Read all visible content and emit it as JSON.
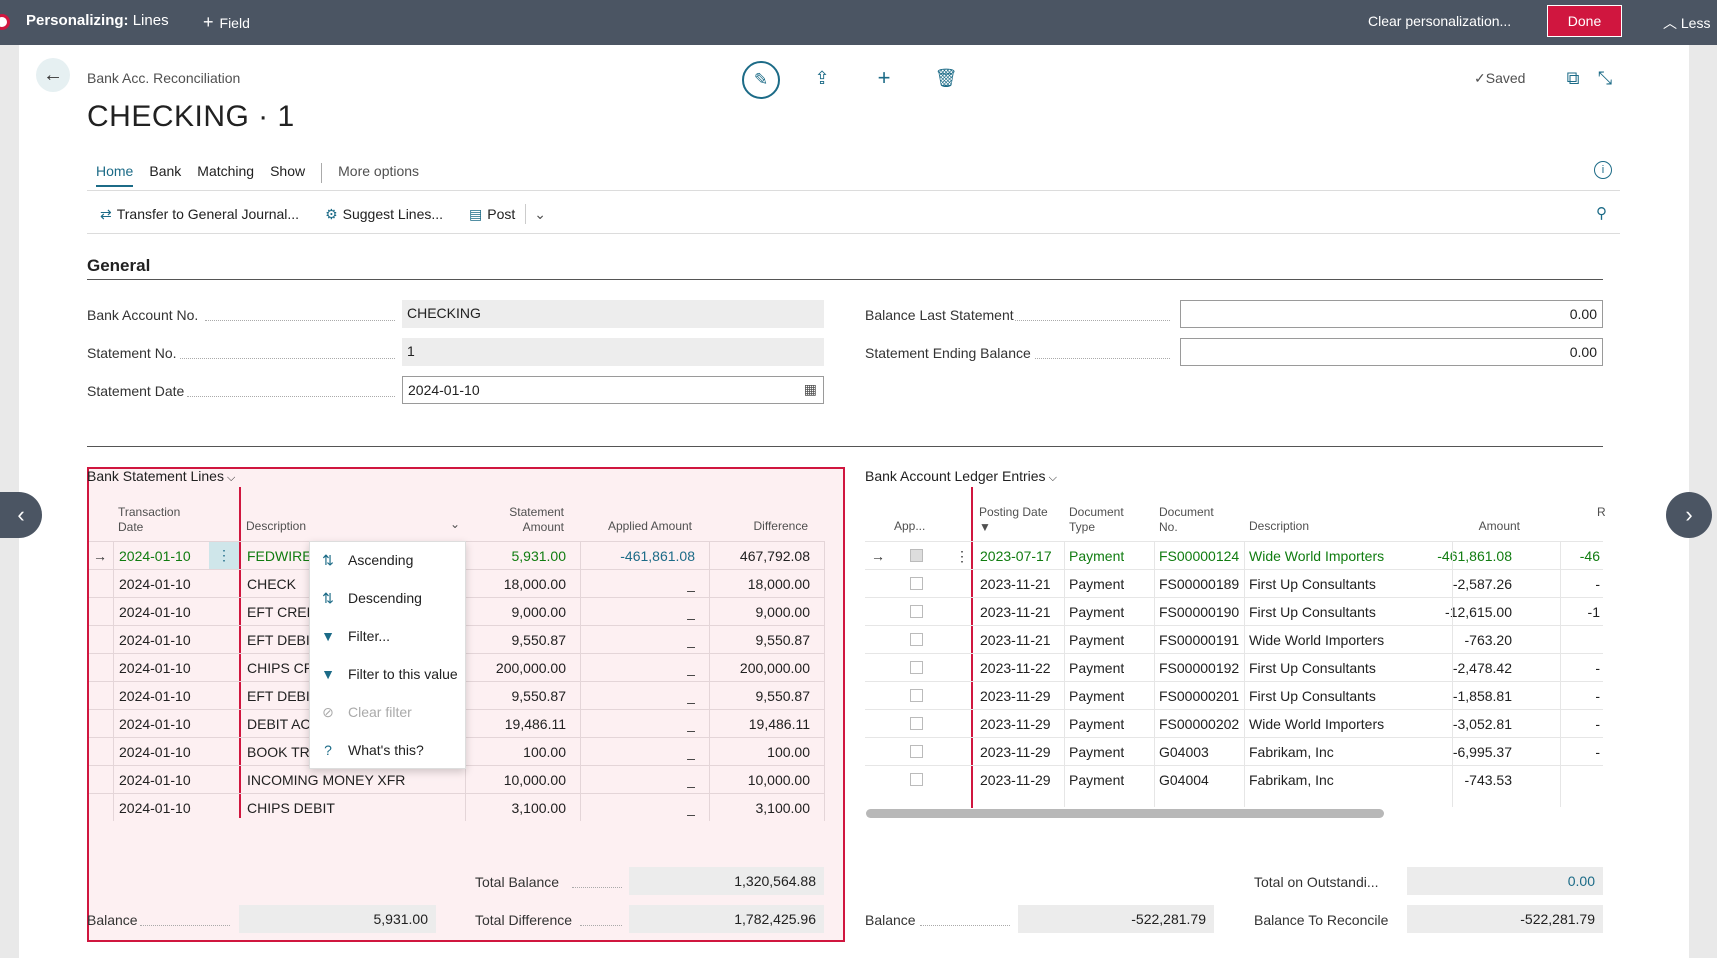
{
  "topbar": {
    "title_bold": "Personalizing:",
    "title_rest": "Lines",
    "field": "Field",
    "clear": "Clear personalization...",
    "done": "Done",
    "less": "Less"
  },
  "header": {
    "breadcrumb": "Bank Acc. Reconciliation",
    "title": "CHECKING · 1",
    "saved": "Saved"
  },
  "tabs": [
    "Home",
    "Bank",
    "Matching",
    "Show",
    "More options"
  ],
  "toolbar": {
    "transfer": "Transfer to General Journal...",
    "suggest": "Suggest Lines...",
    "post": "Post"
  },
  "general": {
    "heading": "General",
    "bank_account_no_label": "Bank Account No.",
    "bank_account_no": "CHECKING",
    "statement_no_label": "Statement No.",
    "statement_no": "1",
    "statement_date_label": "Statement Date",
    "statement_date": "2024-01-10",
    "balance_last_label": "Balance Last Statement",
    "balance_last": "0.00",
    "ending_balance_label": "Statement Ending Balance",
    "ending_balance": "0.00"
  },
  "lines": {
    "title": "Bank Statement Lines",
    "headers": {
      "date1": "Transaction",
      "date2": "Date",
      "desc": "Description",
      "amt1": "Statement",
      "amt2": "Amount",
      "applied": "Applied Amount",
      "diff": "Difference"
    },
    "rows": [
      {
        "date": "2024-01-10",
        "desc": "FEDWIRE",
        "amount": "5,931.00",
        "applied": "-461,861.08",
        "diff": "467,792.08"
      },
      {
        "date": "2024-01-10",
        "desc": "CHECK",
        "amount": "18,000.00",
        "applied": "_",
        "diff": "18,000.00"
      },
      {
        "date": "2024-01-10",
        "desc": "EFT CRED",
        "amount": "9,000.00",
        "applied": "_",
        "diff": "9,000.00"
      },
      {
        "date": "2024-01-10",
        "desc": "EFT DEBIT",
        "amount": "9,550.87",
        "applied": "_",
        "diff": "9,550.87"
      },
      {
        "date": "2024-01-10",
        "desc": "CHIPS CR",
        "amount": "200,000.00",
        "applied": "_",
        "diff": "200,000.00"
      },
      {
        "date": "2024-01-10",
        "desc": "EFT DEBIT",
        "amount": "9,550.87",
        "applied": "_",
        "diff": "9,550.87"
      },
      {
        "date": "2024-01-10",
        "desc": "DEBIT AC",
        "amount": "19,486.11",
        "applied": "_",
        "diff": "19,486.11"
      },
      {
        "date": "2024-01-10",
        "desc": "BOOK TR",
        "amount": "100.00",
        "applied": "_",
        "diff": "100.00"
      },
      {
        "date": "2024-01-10",
        "desc": "INCOMING MONEY XFR",
        "amount": "10,000.00",
        "applied": "_",
        "diff": "10,000.00"
      },
      {
        "date": "2024-01-10",
        "desc": "CHIPS DEBIT",
        "amount": "3,100.00",
        "applied": "_",
        "diff": "3,100.00"
      }
    ],
    "total_balance_label": "Total Balance",
    "total_balance": "1,320,564.88",
    "balance_label": "Balance",
    "balance": "5,931.00",
    "total_diff_label": "Total Difference",
    "total_diff": "1,782,425.96"
  },
  "menu": [
    "Ascending",
    "Descending",
    "Filter...",
    "Filter to this value",
    "Clear filter",
    "What's this?"
  ],
  "ledger": {
    "title": "Bank Account Ledger Entries",
    "headers": {
      "app": "App...",
      "posting1": "Posting Date",
      "doctype1": "Document",
      "doctype2": "Type",
      "docno1": "Document",
      "docno2": "No.",
      "desc": "Description",
      "amount": "Amount",
      "r": "R"
    },
    "rows": [
      {
        "date": "2023-07-17",
        "type": "Payment",
        "no": "FS00000124",
        "desc": "Wide World Importers",
        "amount": "-461,861.08",
        "rem": "-46"
      },
      {
        "date": "2023-11-21",
        "type": "Payment",
        "no": "FS00000189",
        "desc": "First Up Consultants",
        "amount": "-2,587.26",
        "rem": "-"
      },
      {
        "date": "2023-11-21",
        "type": "Payment",
        "no": "FS00000190",
        "desc": "First Up Consultants",
        "amount": "-12,615.00",
        "rem": "-1"
      },
      {
        "date": "2023-11-21",
        "type": "Payment",
        "no": "FS00000191",
        "desc": "Wide World Importers",
        "amount": "-763.20",
        "rem": ""
      },
      {
        "date": "2023-11-22",
        "type": "Payment",
        "no": "FS00000192",
        "desc": "First Up Consultants",
        "amount": "-2,478.42",
        "rem": "-"
      },
      {
        "date": "2023-11-29",
        "type": "Payment",
        "no": "FS00000201",
        "desc": "First Up Consultants",
        "amount": "-1,858.81",
        "rem": "-"
      },
      {
        "date": "2023-11-29",
        "type": "Payment",
        "no": "FS00000202",
        "desc": "Wide World Importers",
        "amount": "-3,052.81",
        "rem": "-"
      },
      {
        "date": "2023-11-29",
        "type": "Payment",
        "no": "G04003",
        "desc": "Fabrikam, Inc",
        "amount": "-6,995.37",
        "rem": "-"
      },
      {
        "date": "2023-11-29",
        "type": "Payment",
        "no": "G04004",
        "desc": "Fabrikam, Inc",
        "amount": "-743.53",
        "rem": ""
      }
    ],
    "total_out_label": "Total on Outstandi...",
    "total_out": "0.00",
    "balance_label": "Balance",
    "balance": "-522,281.79",
    "to_reconcile_label": "Balance To Reconcile",
    "to_reconcile": "-522,281.79"
  }
}
